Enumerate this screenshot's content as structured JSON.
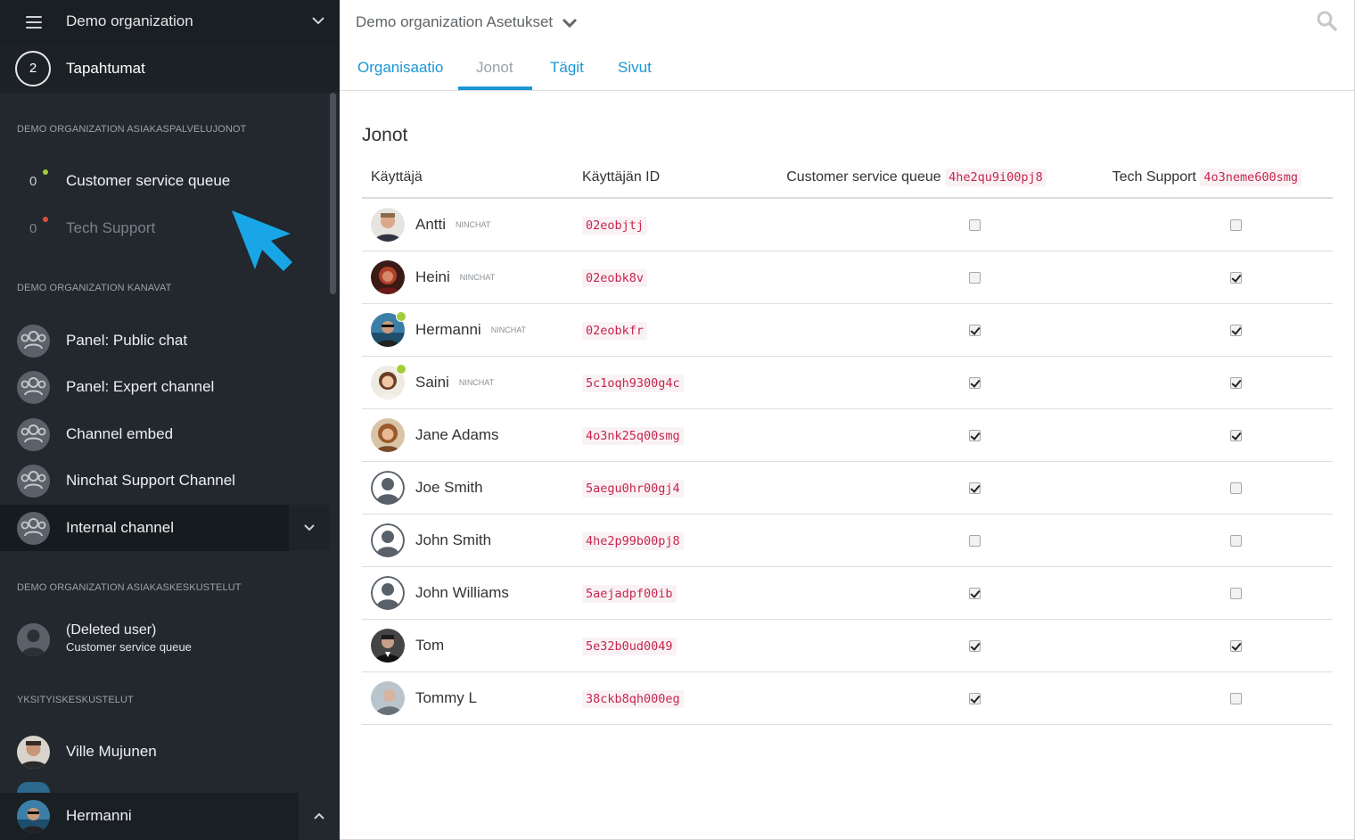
{
  "sidebar": {
    "org_name": "Demo organization",
    "events": {
      "count": "2",
      "label": "Tapahtumat"
    },
    "queues_title": "DEMO ORGANIZATION ASIAKASPALVELUJONOT",
    "queues": [
      {
        "count": "0",
        "name": "Customer service queue",
        "status_color": "#a4cc3a"
      },
      {
        "count": "0",
        "name": "Tech Support",
        "status_color": "#e04b3a"
      }
    ],
    "channels_title": "DEMO ORGANIZATION KANAVAT",
    "channels": [
      {
        "name": "Panel: Public chat"
      },
      {
        "name": "Panel: Expert channel"
      },
      {
        "name": "Channel embed"
      },
      {
        "name": "Ninchat Support Channel"
      },
      {
        "name": "Internal channel"
      }
    ],
    "conversations_title": "DEMO ORGANIZATION ASIAKASKESKUSTELUT",
    "conversations": [
      {
        "name": "(Deleted user)",
        "sub": "Customer service queue"
      }
    ],
    "private_title": "YKSITYISKESKUSTELUT",
    "private": [
      {
        "name": "Ville Mujunen"
      }
    ],
    "current_user": "Hermanni"
  },
  "header": {
    "title": "Demo organization Asetukset",
    "tabs": [
      "Organisaatio",
      "Jonot",
      "Tägit",
      "Sivut"
    ],
    "active_tab": "Jonot"
  },
  "content": {
    "title": "Jonot",
    "columns": {
      "user": "Käyttäjä",
      "user_id": "Käyttäjän ID",
      "q1_name": "Customer service queue",
      "q1_id": "4he2qu9i00pj8",
      "q2_name": "Tech Support",
      "q2_id": "4o3neme600smg"
    },
    "rows": [
      {
        "name": "Antti",
        "badge": "NINCHAT",
        "id": "02eobjtj",
        "q1": false,
        "q2": false,
        "online": false
      },
      {
        "name": "Heini",
        "badge": "NINCHAT",
        "id": "02eobk8v",
        "q1": false,
        "q2": true,
        "online": false
      },
      {
        "name": "Hermanni",
        "badge": "NINCHAT",
        "id": "02eobkfr",
        "q1": true,
        "q2": true,
        "online": true
      },
      {
        "name": "Saini",
        "badge": "NINCHAT",
        "id": "5c1oqh9300g4c",
        "q1": true,
        "q2": true,
        "online": true
      },
      {
        "name": "Jane Adams",
        "badge": "",
        "id": "4o3nk25q00smg",
        "q1": true,
        "q2": true,
        "online": false
      },
      {
        "name": "Joe Smith",
        "badge": "",
        "id": "5aegu0hr00gj4",
        "q1": true,
        "q2": false,
        "online": false
      },
      {
        "name": "John Smith",
        "badge": "",
        "id": "4he2p99b00pj8",
        "q1": false,
        "q2": false,
        "online": false
      },
      {
        "name": "John Williams",
        "badge": "",
        "id": "5aejadpf00ib",
        "q1": true,
        "q2": false,
        "online": false
      },
      {
        "name": "Tom",
        "badge": "",
        "id": "5e32b0ud0049",
        "q1": true,
        "q2": true,
        "online": false
      },
      {
        "name": "Tommy L",
        "badge": "",
        "id": "38ckb8qh000eg",
        "q1": true,
        "q2": false,
        "online": false
      }
    ]
  },
  "colors": {
    "accent": "#1a96d4",
    "sidebar_bg": "#22282e",
    "online": "#a4cc3a",
    "offline": "#e04b3a",
    "code_text": "#c7254e"
  }
}
